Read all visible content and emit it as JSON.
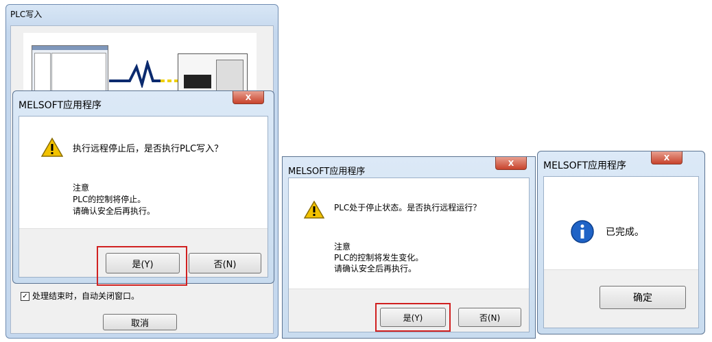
{
  "plc_window": {
    "title": "PLC写入",
    "close_on_finish_label": "处理结束时，自动关闭窗口。",
    "cancel_label": "取消"
  },
  "dialog1": {
    "title": "MELSOFT应用程序",
    "close_glyph": "X",
    "question": "执行远程停止后，是否执行PLC写入？",
    "note_title": "注意",
    "note_line1": "PLC的控制将停止。",
    "note_line2": "请确认安全后再执行。",
    "yes_label": "是(Y)",
    "no_label": "否(N)"
  },
  "dialog2": {
    "title": "MELSOFT应用程序",
    "close_glyph": "X",
    "question": "PLC处于停止状态。是否执行远程运行？",
    "note_title": "注意",
    "note_line1": "PLC的控制将发生变化。",
    "note_line2": "请确认安全后再执行。",
    "yes_label": "是(Y)",
    "no_label": "否(N)"
  },
  "dialog3": {
    "title": "MELSOFT应用程序",
    "close_glyph": "X",
    "message": "已完成。",
    "ok_label": "确定"
  },
  "icons": {
    "warning": "warning-icon",
    "info": "info-icon"
  },
  "colors": {
    "highlight": "#d02020",
    "warning_yellow": "#f2c200",
    "info_blue": "#1f63c6"
  }
}
